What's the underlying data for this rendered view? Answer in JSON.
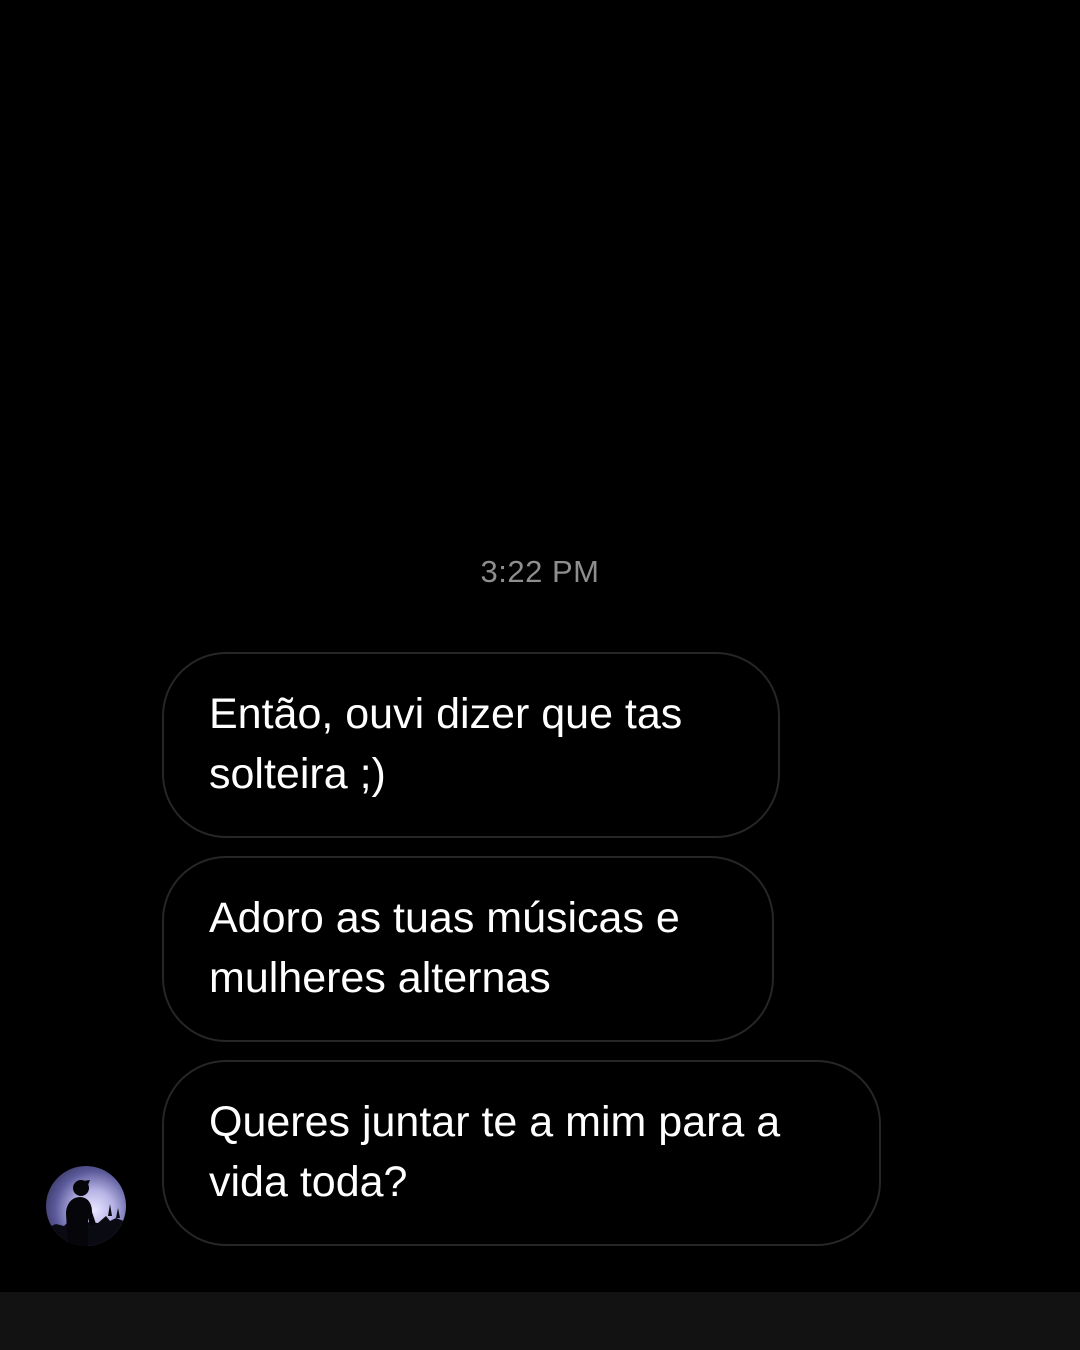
{
  "conversation": {
    "timestamp": "3:22 PM",
    "messages": [
      {
        "text": "Então, ouvi dizer que tas solteira ;)"
      },
      {
        "text": "Adoro as tuas músicas e mulheres alternas"
      },
      {
        "text": "Queres juntar te a mim para a vida toda?"
      }
    ]
  },
  "sender": {
    "avatar_icon": "person-silhouette-avatar"
  },
  "colors": {
    "background": "#000000",
    "bubble_border": "#262626",
    "message_text": "#ffffff",
    "timestamp_text": "#8e8e8e",
    "bottom_bar": "#121212"
  }
}
